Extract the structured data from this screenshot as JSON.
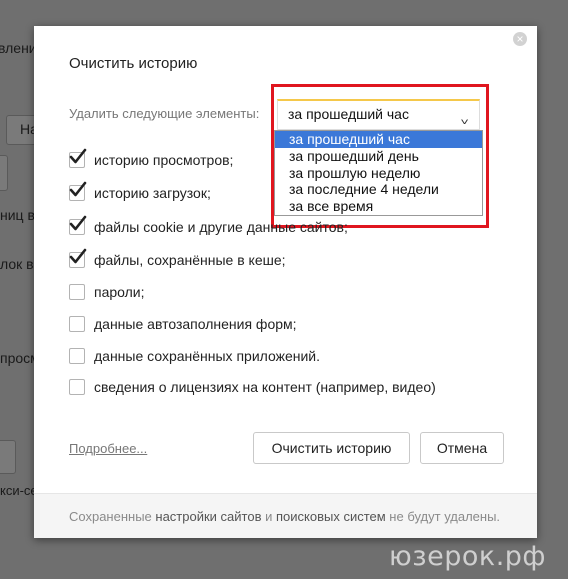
{
  "background": {
    "fragments": [
      "вление",
      "На",
      "ниц в",
      "лок в",
      "просм",
      "кси-сер"
    ]
  },
  "dialog": {
    "title": "Очистить историю",
    "delete_label": "Удалить следующие элементы:",
    "period_select": {
      "value": "за прошедший час",
      "options": [
        "за прошедший час",
        "за прошедший день",
        "за прошлую неделю",
        "за последние 4 недели",
        "за все время"
      ]
    },
    "checkboxes": [
      {
        "label": "историю просмотров;",
        "checked": true
      },
      {
        "label": "историю загрузок;",
        "checked": true
      },
      {
        "label": "файлы cookie и другие данные сайтов;",
        "checked": true
      },
      {
        "label": "файлы, сохранённые в кеше;",
        "checked": true
      },
      {
        "label": "пароли;",
        "checked": false
      },
      {
        "label": "данные автозаполнения форм;",
        "checked": false
      },
      {
        "label": "данные сохранённых приложений.",
        "checked": false
      },
      {
        "label": "сведения о лицензиях на контент (например, видео)",
        "checked": false
      }
    ],
    "more_link": "Подробнее...",
    "clear_button": "Очистить историю",
    "cancel_button": "Отмена",
    "footer": {
      "part1": "Сохраненные ",
      "part2": "настройки сайтов",
      "part3": " и ",
      "part4": "поисковых систем",
      "part5": " не будут удалены."
    }
  },
  "colors": {
    "highlight": "#e0161f",
    "selected_option": "#3b78d8",
    "select_accent": "#f5c84a"
  },
  "watermark": "юзерок.рф"
}
